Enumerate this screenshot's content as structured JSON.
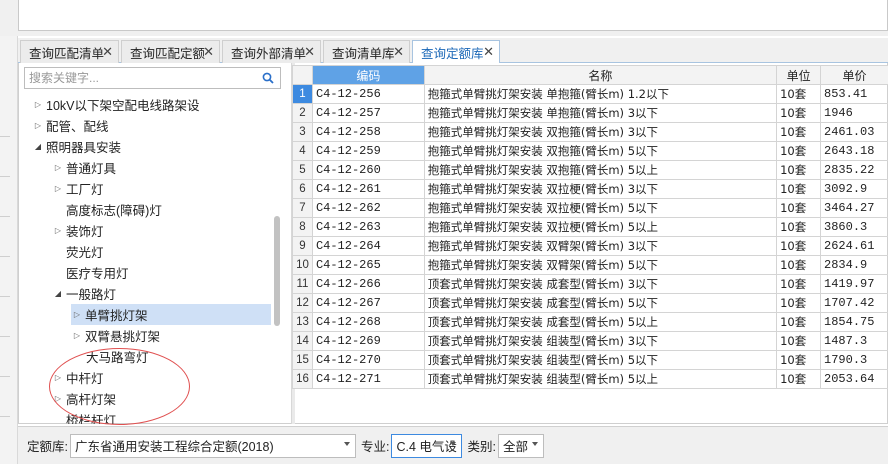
{
  "tabs": [
    {
      "label": "查询匹配清单",
      "active": false
    },
    {
      "label": "查询匹配定额",
      "active": false
    },
    {
      "label": "查询外部清单",
      "active": false
    },
    {
      "label": "查询清单库",
      "active": false
    },
    {
      "label": "查询定额库",
      "active": true
    }
  ],
  "search": {
    "placeholder": "搜索关键字..."
  },
  "tree": [
    {
      "label": "10kV以下架空配电线路架设",
      "arrow": "collapsed",
      "level": 0
    },
    {
      "label": "配管、配线",
      "arrow": "collapsed",
      "level": 0
    },
    {
      "label": "照明器具安装",
      "arrow": "expanded",
      "level": 0
    },
    {
      "label": "普通灯具",
      "arrow": "collapsed",
      "level": 1
    },
    {
      "label": "工厂灯",
      "arrow": "collapsed",
      "level": 1
    },
    {
      "label": "高度标志(障碍)灯",
      "arrow": "none",
      "level": 1
    },
    {
      "label": "装饰灯",
      "arrow": "collapsed",
      "level": 1
    },
    {
      "label": "荧光灯",
      "arrow": "none",
      "level": 1
    },
    {
      "label": "医疗专用灯",
      "arrow": "none",
      "level": 1
    },
    {
      "label": "一般路灯",
      "arrow": "expanded",
      "level": 1
    },
    {
      "label": "单臂挑灯架",
      "arrow": "collapsed",
      "level": 2,
      "selected": true
    },
    {
      "label": "双臂悬挑灯架",
      "arrow": "collapsed",
      "level": 2
    },
    {
      "label": "大马路弯灯",
      "arrow": "none",
      "level": 2
    },
    {
      "label": "中杆灯",
      "arrow": "collapsed",
      "level": 1
    },
    {
      "label": "高杆灯架",
      "arrow": "collapsed",
      "level": 1
    },
    {
      "label": "桥栏杆灯",
      "arrow": "none",
      "level": 1
    }
  ],
  "grid": {
    "headers": {
      "code": "编码",
      "name": "名称",
      "unit": "单位",
      "price": "单价"
    },
    "rows": [
      {
        "num": "1",
        "code": "C4-12-256",
        "name": "抱箍式单臂挑灯架安装 单抱箍(臂长m) 1.2以下",
        "unit": "10套",
        "price": "853.41"
      },
      {
        "num": "2",
        "code": "C4-12-257",
        "name": "抱箍式单臂挑灯架安装 单抱箍(臂长m) 3以下",
        "unit": "10套",
        "price": "1946"
      },
      {
        "num": "3",
        "code": "C4-12-258",
        "name": "抱箍式单臂挑灯架安装 双抱箍(臂长m) 3以下",
        "unit": "10套",
        "price": "2461.03"
      },
      {
        "num": "4",
        "code": "C4-12-259",
        "name": "抱箍式单臂挑灯架安装 双抱箍(臂长m) 5以下",
        "unit": "10套",
        "price": "2643.18"
      },
      {
        "num": "5",
        "code": "C4-12-260",
        "name": "抱箍式单臂挑灯架安装 双抱箍(臂长m) 5以上",
        "unit": "10套",
        "price": "2835.22"
      },
      {
        "num": "6",
        "code": "C4-12-261",
        "name": "抱箍式单臂挑灯架安装 双拉梗(臂长m) 3以下",
        "unit": "10套",
        "price": "3092.9"
      },
      {
        "num": "7",
        "code": "C4-12-262",
        "name": "抱箍式单臂挑灯架安装 双拉梗(臂长m) 5以下",
        "unit": "10套",
        "price": "3464.27"
      },
      {
        "num": "8",
        "code": "C4-12-263",
        "name": "抱箍式单臂挑灯架安装 双拉梗(臂长m) 5以上",
        "unit": "10套",
        "price": "3860.3"
      },
      {
        "num": "9",
        "code": "C4-12-264",
        "name": "抱箍式单臂挑灯架安装 双臂架(臂长m) 3以下",
        "unit": "10套",
        "price": "2624.61"
      },
      {
        "num": "10",
        "code": "C4-12-265",
        "name": "抱箍式单臂挑灯架安装 双臂架(臂长m) 5以下",
        "unit": "10套",
        "price": "2834.9"
      },
      {
        "num": "11",
        "code": "C4-12-266",
        "name": "顶套式单臂挑灯架安装 成套型(臂长m) 3以下",
        "unit": "10套",
        "price": "1419.97"
      },
      {
        "num": "12",
        "code": "C4-12-267",
        "name": "顶套式单臂挑灯架安装 成套型(臂长m) 5以下",
        "unit": "10套",
        "price": "1707.42"
      },
      {
        "num": "13",
        "code": "C4-12-268",
        "name": "顶套式单臂挑灯架安装 成套型(臂长m) 5以上",
        "unit": "10套",
        "price": "1854.75"
      },
      {
        "num": "14",
        "code": "C4-12-269",
        "name": "顶套式单臂挑灯架安装 组装型(臂长m) 3以下",
        "unit": "10套",
        "price": "1487.3"
      },
      {
        "num": "15",
        "code": "C4-12-270",
        "name": "顶套式单臂挑灯架安装 组装型(臂长m) 5以下",
        "unit": "10套",
        "price": "1790.3"
      },
      {
        "num": "16",
        "code": "C4-12-271",
        "name": "顶套式单臂挑灯架安装 组装型(臂长m) 5以上",
        "unit": "10套",
        "price": "2053.64"
      }
    ]
  },
  "bottom": {
    "quota_label": "定额库:",
    "quota_value": "广东省通用安装工程综合定额(2018)",
    "major_label": "专业:",
    "major_value": "C.4 电气设",
    "category_label": "类别:",
    "category_value": "全部"
  },
  "colors": {
    "accent": "#1a67b7",
    "selected_row": "#3d8ae0",
    "annotation_circle": "#e05050"
  },
  "icons": {
    "search": "search-icon",
    "close": "close-icon",
    "tree_arrow": "chevron-icon",
    "dropdown": "chevron-down-icon"
  }
}
